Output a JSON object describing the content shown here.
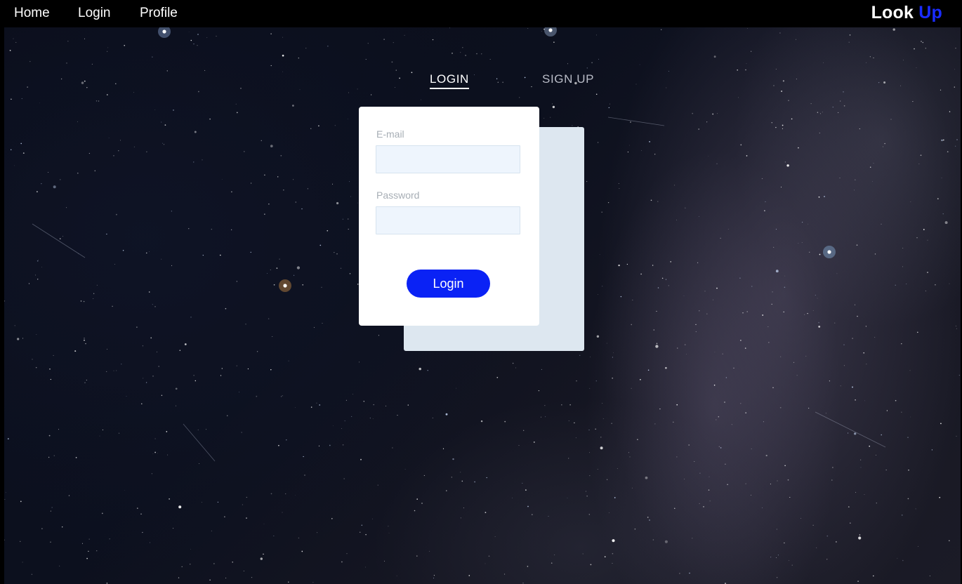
{
  "nav": {
    "links": [
      "Home",
      "Login",
      "Profile"
    ],
    "brand_first": "Look",
    "brand_second": "Up",
    "brand_accent_color": "#1a2cff"
  },
  "auth_tabs": {
    "login": "LOGIN",
    "signup": "SIGN UP",
    "active": "login"
  },
  "form": {
    "email_label": "E-mail",
    "email_value": "",
    "password_label": "Password",
    "password_value": "",
    "submit_label": "Login",
    "button_color": "#0a22f5"
  },
  "background": "starry night sky"
}
